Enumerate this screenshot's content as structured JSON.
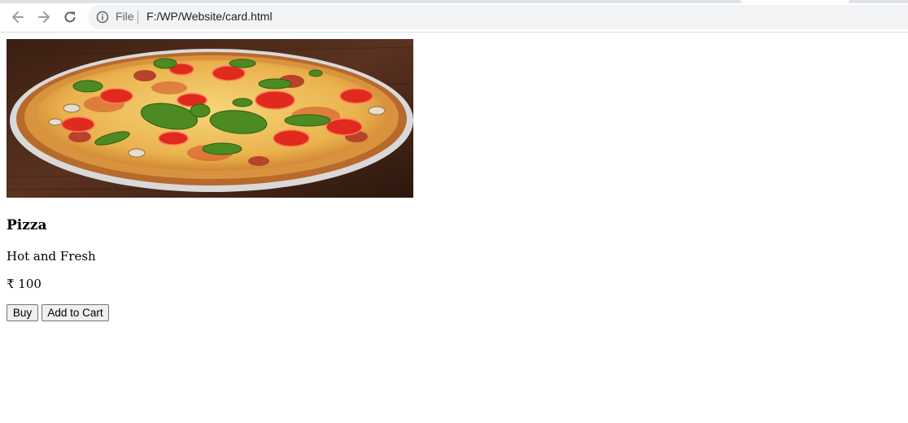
{
  "browser": {
    "scheme_label": "File",
    "url": "F:/WP/Website/card.html"
  },
  "card": {
    "title": "Pizza",
    "description": "Hot and Fresh",
    "price": "₹ 100",
    "buy_label": "Buy",
    "add_to_cart_label": "Add to Cart"
  },
  "colors": {
    "toolbar_bg": "#ffffff",
    "omnibox_bg": "#f1f3f4",
    "icon_gray": "#5f6368",
    "disabled_gray": "#9aa0a6"
  }
}
